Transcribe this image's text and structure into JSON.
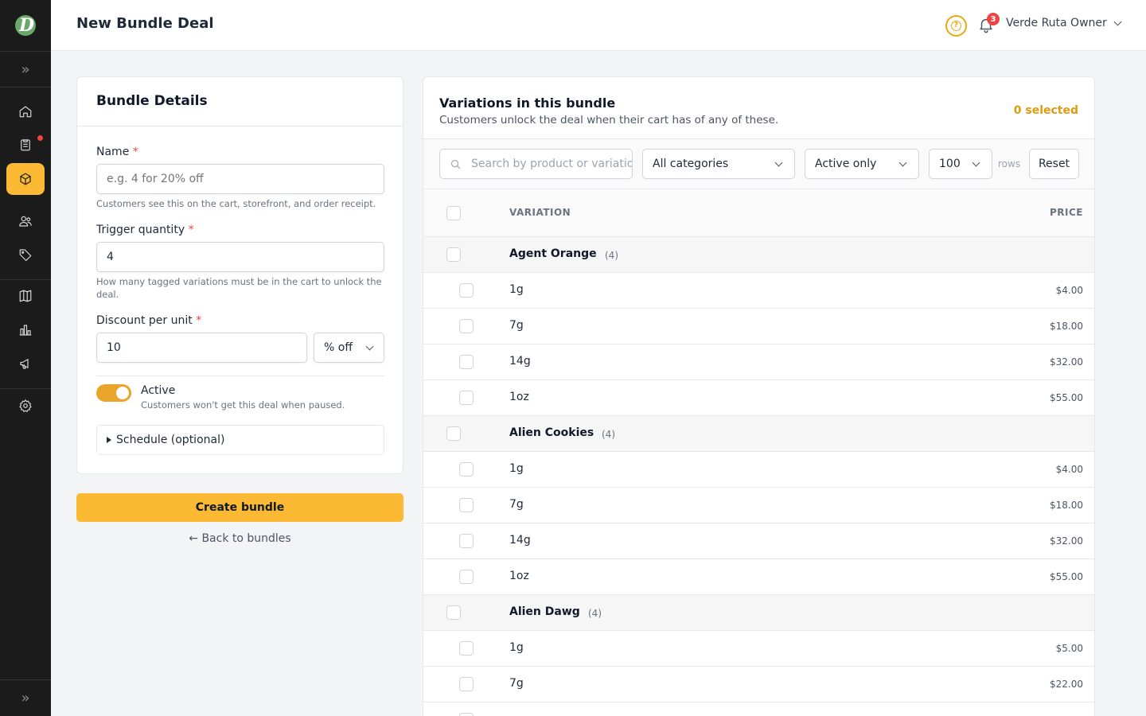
{
  "header": {
    "title": "New Bundle Deal",
    "user_name": "Verde Ruta Owner",
    "notification_count": "3"
  },
  "sidebar": {
    "logo_letter": "D",
    "items": [
      {
        "icon": "home-icon"
      },
      {
        "icon": "orders-icon",
        "has_alert": true
      },
      {
        "icon": "box-icon",
        "active": true
      },
      {
        "icon": "users-icon"
      },
      {
        "icon": "tag-icon"
      },
      {
        "icon": "book-icon"
      },
      {
        "icon": "chart-icon"
      },
      {
        "icon": "megaphone-icon"
      },
      {
        "icon": "settings-icon"
      }
    ]
  },
  "details": {
    "title": "Bundle Details",
    "name_label": "Name",
    "name_placeholder": "e.g. 4 for 20% off",
    "name_help": "Customers see this on the cart, storefront, and order receipt.",
    "trigger_label": "Trigger quantity",
    "trigger_value": "4",
    "trigger_help": "How many tagged variations must be in the cart to unlock the deal.",
    "discount_label": "Discount per unit",
    "discount_value": "10",
    "discount_type": "% off",
    "required_mark": "*",
    "active_label": "Active",
    "active_on": true,
    "active_help": "Customers won't get this deal when paused.",
    "schedule_label": "Schedule (optional)",
    "create_label": "Create bundle",
    "back_label": "← Back to bundles"
  },
  "variations": {
    "title": "Variations in this bundle",
    "subtitle": "Customers unlock the deal when their cart has of any of these.",
    "selected_label": "0 selected",
    "search_placeholder": "Search by product or variation",
    "category_filter": "All categories",
    "status_filter": "Active only",
    "rows_per_page": "100",
    "rows_label": "rows",
    "reset_label": "Reset",
    "col_variation": "VARIATION",
    "col_price": "PRICE",
    "groups": [
      {
        "name": "Agent Orange",
        "count": "(4)",
        "items": [
          {
            "name": "1g",
            "price": "$4.00"
          },
          {
            "name": "7g",
            "price": "$18.00"
          },
          {
            "name": "14g",
            "price": "$32.00"
          },
          {
            "name": "1oz",
            "price": "$55.00"
          }
        ]
      },
      {
        "name": "Alien Cookies",
        "count": "(4)",
        "items": [
          {
            "name": "1g",
            "price": "$4.00"
          },
          {
            "name": "7g",
            "price": "$18.00"
          },
          {
            "name": "14g",
            "price": "$32.00"
          },
          {
            "name": "1oz",
            "price": "$55.00"
          }
        ]
      },
      {
        "name": "Alien Dawg",
        "count": "(4)",
        "items": [
          {
            "name": "1g",
            "price": "$5.00"
          },
          {
            "name": "7g",
            "price": "$22.00"
          },
          {
            "name": "",
            "price": ""
          }
        ]
      }
    ]
  }
}
